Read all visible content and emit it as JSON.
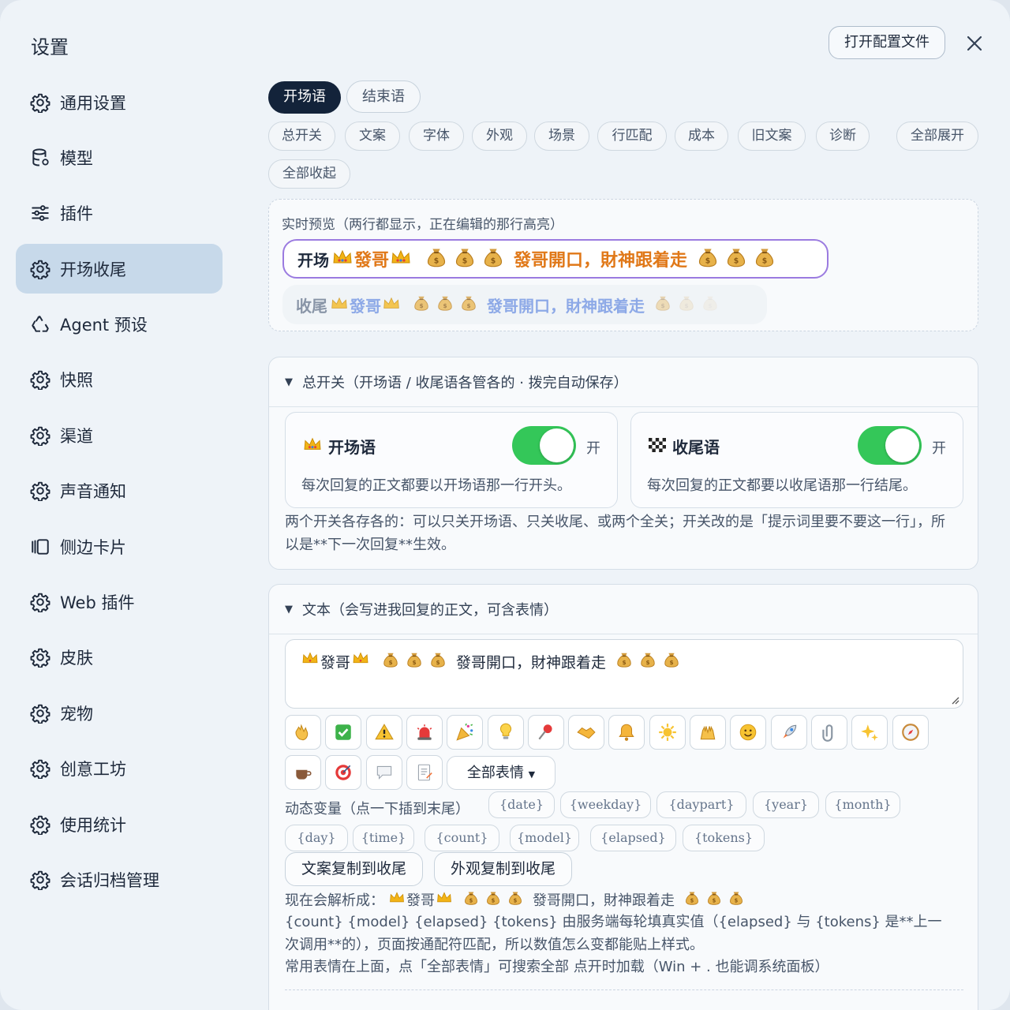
{
  "window": {
    "title": "设置",
    "open_config_label": "打开配置文件",
    "close_icon": "close-icon"
  },
  "sidebar": {
    "items": [
      {
        "label": "通用设置",
        "icon": "gear-icon",
        "active": false
      },
      {
        "label": "模型",
        "icon": "database-icon",
        "active": false
      },
      {
        "label": "插件",
        "icon": "sliders-icon",
        "active": false
      },
      {
        "label": "开场收尾",
        "icon": "gear-icon",
        "active": true
      },
      {
        "label": "Agent 预设",
        "icon": "recycle-icon",
        "active": false
      },
      {
        "label": "快照",
        "icon": "gear-icon",
        "active": false
      },
      {
        "label": "渠道",
        "icon": "gear-icon",
        "active": false
      },
      {
        "label": "声音通知",
        "icon": "gear-icon",
        "active": false
      },
      {
        "label": "侧边卡片",
        "icon": "cards-icon",
        "active": false
      },
      {
        "label": "Web 插件",
        "icon": "gear-icon",
        "active": false
      },
      {
        "label": "皮肤",
        "icon": "gear-icon",
        "active": false
      },
      {
        "label": "宠物",
        "icon": "gear-icon",
        "active": false
      },
      {
        "label": "创意工坊",
        "icon": "gear-icon",
        "active": false
      },
      {
        "label": "使用统计",
        "icon": "gear-icon",
        "active": false
      },
      {
        "label": "会话归档管理",
        "icon": "gear-icon",
        "active": false
      }
    ]
  },
  "tabs": [
    {
      "label": "开场语",
      "active": true
    },
    {
      "label": "结束语",
      "active": false
    }
  ],
  "section_chips": [
    "总开关",
    "文案",
    "字体",
    "外观",
    "场景",
    "行匹配",
    "成本",
    "旧文案",
    "诊断",
    "全部展开",
    "全部收起"
  ],
  "preview": {
    "label": "实时预览（两行都显示，正在编辑的那行高亮）",
    "open_tag": "开场",
    "close_tag": "收尾",
    "name": "發哥",
    "phrase": "發哥開口，財神跟着走"
  },
  "master_switch": {
    "header": "总开关（开场语 / 收尾语各管各的 · 拨完自动保存）",
    "open_card": {
      "icon": "crown-icon",
      "title": "开场语",
      "state_label": "开",
      "on": true,
      "desc": "每次回复的正文都要以开场语那一行开头。"
    },
    "close_card": {
      "icon": "checkered-flag-icon",
      "title": "收尾语",
      "state_label": "开",
      "on": true,
      "desc": "每次回复的正文都要以收尾语那一行结尾。"
    },
    "note": "两个开关各存各的：可以只关开场语、只关收尾、或两个全关；开关改的是「提示词里要不要这一行」，所以是**下一次回复**生效。"
  },
  "text_section": {
    "header": "文本（会写进我回复的正文，可含表情）",
    "textarea_name": "發哥",
    "textarea_phrase": "發哥開口，財神跟着走",
    "emojis": [
      "wave-icon",
      "check-icon",
      "warning-icon",
      "siren-icon",
      "party-icon",
      "bulb-icon",
      "pin-icon",
      "handshake-icon",
      "bell-icon",
      "sun-icon",
      "raised-hands-icon",
      "smile-icon",
      "rocket-icon",
      "paperclip-icon",
      "sparkles-icon",
      "compass-icon",
      "coffee-icon",
      "target-icon",
      "speech-icon",
      "memo-icon"
    ],
    "all_emoji_label": "全部表情",
    "vars_label": "动态变量（点一下插到末尾）",
    "vars": [
      "{date}",
      "{weekday}",
      "{daypart}",
      "{year}",
      "{month}",
      "{day}",
      "{time}",
      "{count}",
      "{model}",
      "{elapsed}",
      "{tokens}"
    ],
    "copy_text_label": "文案复制到收尾",
    "copy_look_label": "外观复制到收尾",
    "parse_label": "现在会解析成：",
    "parse_name": "發哥",
    "parse_phrase": "發哥開口，財神跟着走",
    "info_line1": "{count} {model} {elapsed} {tokens} 由服务端每轮填真实值（{elapsed} 与 {tokens} 是**上一次调用**的），页面按通配符匹配，所以数值怎么变都能贴上样式。",
    "info_line2": "常用表情在上面，点「全部表情」可搜索全部 点开时加载（Win + . 也能调系统面板）"
  },
  "colors": {
    "accent_dark": "#13233a",
    "toggle_on": "#34c759",
    "highlight_border": "#9b7be0",
    "preview_text_open": "#e07818",
    "preview_text_close": "#6a8fe0",
    "sidebar_active": "#c7d9ea"
  }
}
